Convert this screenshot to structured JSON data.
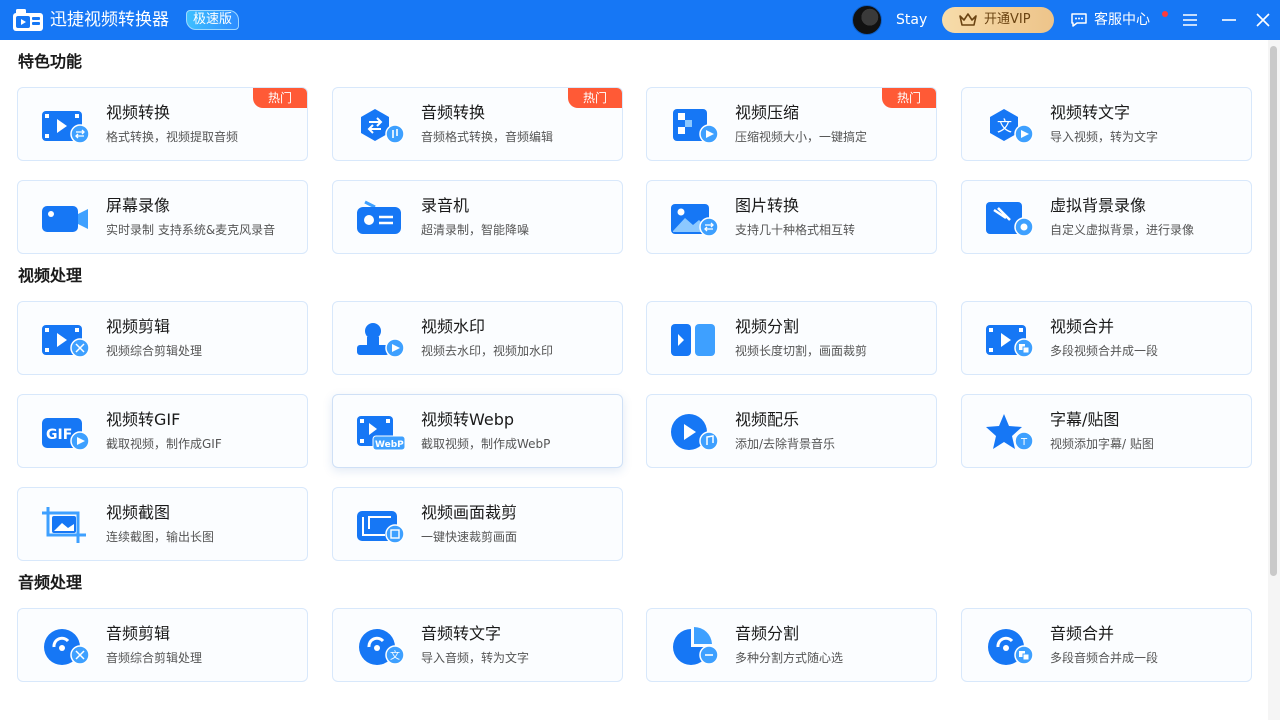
{
  "app": {
    "title": "迅捷视频转换器",
    "edition": "极速版",
    "username": "Stay",
    "vip_label": "开通VIP",
    "service_label": "客服中心"
  },
  "colors": {
    "titlebar": "#1677f5",
    "accent": "#1677f5",
    "hot_badge": "#ff5a36",
    "vip": "#f2d19c"
  },
  "sections": [
    {
      "title": "特色功能",
      "cards": [
        {
          "name": "视频转换",
          "desc": "格式转换，视频提取音频",
          "hot": "热门",
          "icon": "video-convert-icon"
        },
        {
          "name": "音频转换",
          "desc": "音频格式转换，音频编辑",
          "hot": "热门",
          "icon": "audio-convert-icon"
        },
        {
          "name": "视频压缩",
          "desc": "压缩视频大小，一键搞定",
          "hot": "热门",
          "icon": "video-compress-icon"
        },
        {
          "name": "视频转文字",
          "desc": "导入视频，转为文字",
          "hot": "",
          "icon": "video-to-text-icon"
        },
        {
          "name": "屏幕录像",
          "desc": "实时录制 支持系统&麦克风录音",
          "hot": "",
          "icon": "screen-record-icon"
        },
        {
          "name": "录音机",
          "desc": "超清录制，智能降噪",
          "hot": "",
          "icon": "recorder-icon"
        },
        {
          "name": "图片转换",
          "desc": "支持几十种格式相互转",
          "hot": "",
          "icon": "image-convert-icon"
        },
        {
          "name": "虚拟背景录像",
          "desc": "自定义虚拟背景，进行录像",
          "hot": "",
          "icon": "virtual-background-icon"
        }
      ]
    },
    {
      "title": "视频处理",
      "cards": [
        {
          "name": "视频剪辑",
          "desc": "视频综合剪辑处理",
          "hot": "",
          "icon": "video-edit-icon"
        },
        {
          "name": "视频水印",
          "desc": "视频去水印，视频加水印",
          "hot": "",
          "icon": "video-watermark-icon"
        },
        {
          "name": "视频分割",
          "desc": "视频长度切割，画面裁剪",
          "hot": "",
          "icon": "video-split-icon"
        },
        {
          "name": "视频合并",
          "desc": "多段视频合并成一段",
          "hot": "",
          "icon": "video-merge-icon"
        },
        {
          "name": "视频转GIF",
          "desc": "截取视频，制作成GIF",
          "hot": "",
          "icon": "video-to-gif-icon"
        },
        {
          "name": "视频转Webp",
          "desc": "截取视频，制作成WebP",
          "hot": "",
          "icon": "video-to-webp-icon"
        },
        {
          "name": "视频配乐",
          "desc": "添加/去除背景音乐",
          "hot": "",
          "icon": "video-music-icon"
        },
        {
          "name": "字幕/贴图",
          "desc": "视频添加字幕/ 贴图",
          "hot": "",
          "icon": "subtitle-sticker-icon"
        },
        {
          "name": "视频截图",
          "desc": "连续截图，输出长图",
          "hot": "",
          "icon": "video-screenshot-icon"
        },
        {
          "name": "视频画面裁剪",
          "desc": "一键快速裁剪画面",
          "hot": "",
          "icon": "video-crop-icon"
        }
      ]
    },
    {
      "title": "音频处理",
      "cards": [
        {
          "name": "音频剪辑",
          "desc": "音频综合剪辑处理",
          "hot": "",
          "icon": "audio-edit-icon"
        },
        {
          "name": "音频转文字",
          "desc": "导入音频，转为文字",
          "hot": "",
          "icon": "audio-to-text-icon"
        },
        {
          "name": "音频分割",
          "desc": "多种分割方式随心选",
          "hot": "",
          "icon": "audio-split-icon"
        },
        {
          "name": "音频合并",
          "desc": "多段音频合并成一段",
          "hot": "",
          "icon": "audio-merge-icon"
        }
      ]
    }
  ]
}
